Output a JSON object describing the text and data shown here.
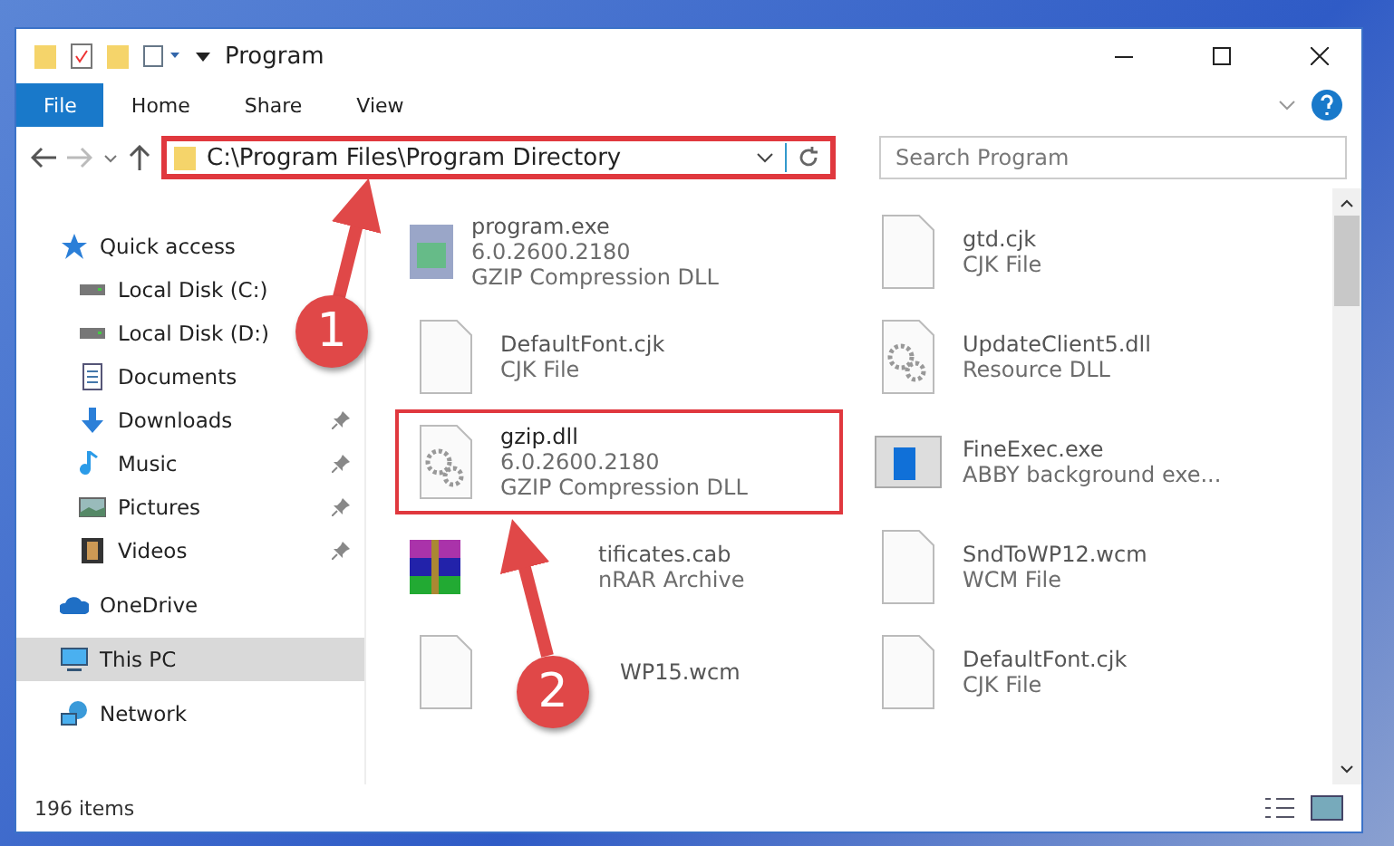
{
  "window": {
    "title": "Program"
  },
  "ribbon": {
    "tabs": [
      {
        "label": "File",
        "selected": true
      },
      {
        "label": "Home",
        "selected": false
      },
      {
        "label": "Share",
        "selected": false
      },
      {
        "label": "View",
        "selected": false
      }
    ]
  },
  "address": {
    "path": "C:\\Program Files\\Program Directory",
    "highlighted": true
  },
  "search": {
    "placeholder": "Search Program"
  },
  "sidebar": {
    "items": [
      {
        "label": "Quick access",
        "kind": "star",
        "pinned": false,
        "selected": false,
        "children": [
          {
            "label": "Local Disk (C:)",
            "kind": "disk",
            "pinned": false,
            "selected": false
          },
          {
            "label": "Local Disk (D:)",
            "kind": "disk",
            "pinned": false,
            "selected": false
          },
          {
            "label": "Documents",
            "kind": "docs",
            "pinned": false,
            "selected": false
          },
          {
            "label": "Downloads",
            "kind": "download",
            "pinned": true,
            "selected": false
          },
          {
            "label": "Music",
            "kind": "music",
            "pinned": true,
            "selected": false
          },
          {
            "label": "Pictures",
            "kind": "pictures",
            "pinned": true,
            "selected": false
          },
          {
            "label": "Videos",
            "kind": "videos",
            "pinned": true,
            "selected": false
          }
        ]
      },
      {
        "label": "OneDrive",
        "kind": "cloud",
        "pinned": false,
        "selected": false
      },
      {
        "label": "This PC",
        "kind": "pc",
        "pinned": false,
        "selected": true
      },
      {
        "label": "Network",
        "kind": "network",
        "pinned": false,
        "selected": false
      }
    ]
  },
  "files": [
    {
      "name": "program.exe",
      "lines": [
        "6.0.2600.2180",
        "GZIP Compression DLL"
      ],
      "kind": "exe",
      "covered": false,
      "highlighted": false
    },
    {
      "name": "gtd.cjk",
      "lines": [
        "CJK File"
      ],
      "kind": "file",
      "covered": false,
      "highlighted": false
    },
    {
      "name": "DefaultFont.cjk",
      "lines": [
        "CJK File"
      ],
      "kind": "file",
      "covered": false,
      "highlighted": false
    },
    {
      "name": "UpdateClient5.dll",
      "lines": [
        "Resource DLL"
      ],
      "kind": "dll",
      "covered": false,
      "highlighted": false
    },
    {
      "name": "gzip.dll",
      "lines": [
        "6.0.2600.2180",
        "GZIP Compression DLL"
      ],
      "kind": "dll",
      "covered": false,
      "highlighted": true
    },
    {
      "name": "FineExec.exe",
      "lines": [
        "ABBY background exe..."
      ],
      "kind": "app",
      "covered": false,
      "highlighted": false
    },
    {
      "name": "tificates.cab",
      "lines": [
        "nRAR Archive"
      ],
      "kind": "archive",
      "covered": true,
      "highlighted": false
    },
    {
      "name": "SndToWP12.wcm",
      "lines": [
        "WCM File"
      ],
      "kind": "file",
      "covered": false,
      "highlighted": false
    },
    {
      "name": "WP15.wcm",
      "kind": "file",
      "covered": true,
      "highlighted": false
    },
    {
      "name": "DefaultFont.cjk",
      "lines": [
        "CJK File"
      ],
      "kind": "file",
      "covered": false,
      "highlighted": false
    }
  ],
  "status_bar": {
    "count": "196 items"
  },
  "annotations": [
    {
      "number": "1"
    },
    {
      "number": "2"
    }
  ]
}
